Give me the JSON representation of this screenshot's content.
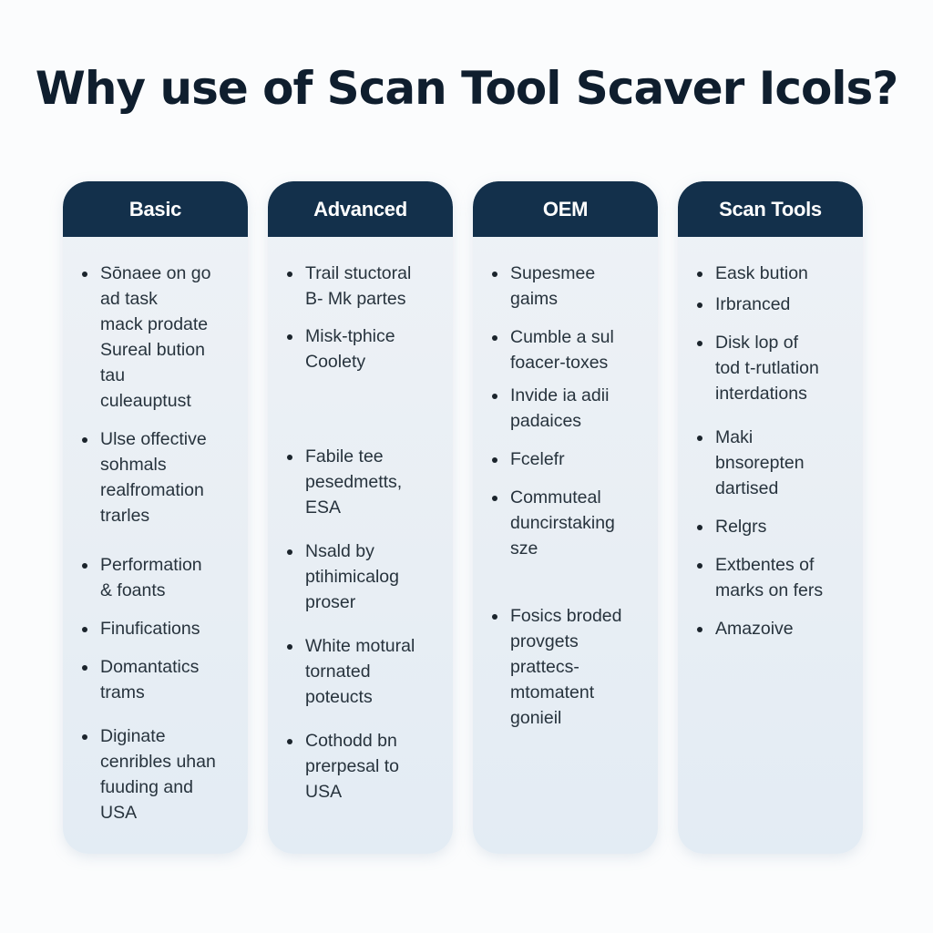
{
  "title": "Why use of Scan Tool Scaver Icols?",
  "columns": [
    {
      "header": "Basic",
      "items": [
        "Sōnaee on go\nad task\nmack prodate\nSureal bution\ntau\nculeauptust",
        "Ulse offective\nsohmals\nrealfromation\ntrarles",
        "Performation\n& foants",
        "Finufications",
        "Domantatics\ntrams",
        "Diginate\ncenribles uhan\nfuuding and\nUSA"
      ]
    },
    {
      "header": "Advanced",
      "items": [
        "Trail stuctoral\nB- Mk partes",
        "Misk-tphice\nCoolety",
        "Fabile tee\npesedmetts,\nESA",
        "Nsald by\nptihimicalog\nproser",
        "White motural\ntornated\npoteucts",
        "Cothodd bn\nprerpesal to\nUSA"
      ]
    },
    {
      "header": "OEM",
      "items": [
        "Supesmee\ngaims",
        "Cumble a sul\nfoacer-toxes",
        "Invide ia adii\npadaices",
        "Fcelefr",
        "Commuteal\nduncirstaking\nsze",
        "Fosics broded\nprovgets\nprattecs-\nmtomatent\ngonieil"
      ]
    },
    {
      "header": "Scan Tools",
      "items": [
        "Eask bution",
        "Irbranced",
        "Disk lop of\ntod t-rutlation\ninterdations",
        "Maki\nbnsorepten\ndartised",
        "Relgrs",
        "Extbentes of\nmarks on fers",
        "Amazoive"
      ]
    }
  ]
}
